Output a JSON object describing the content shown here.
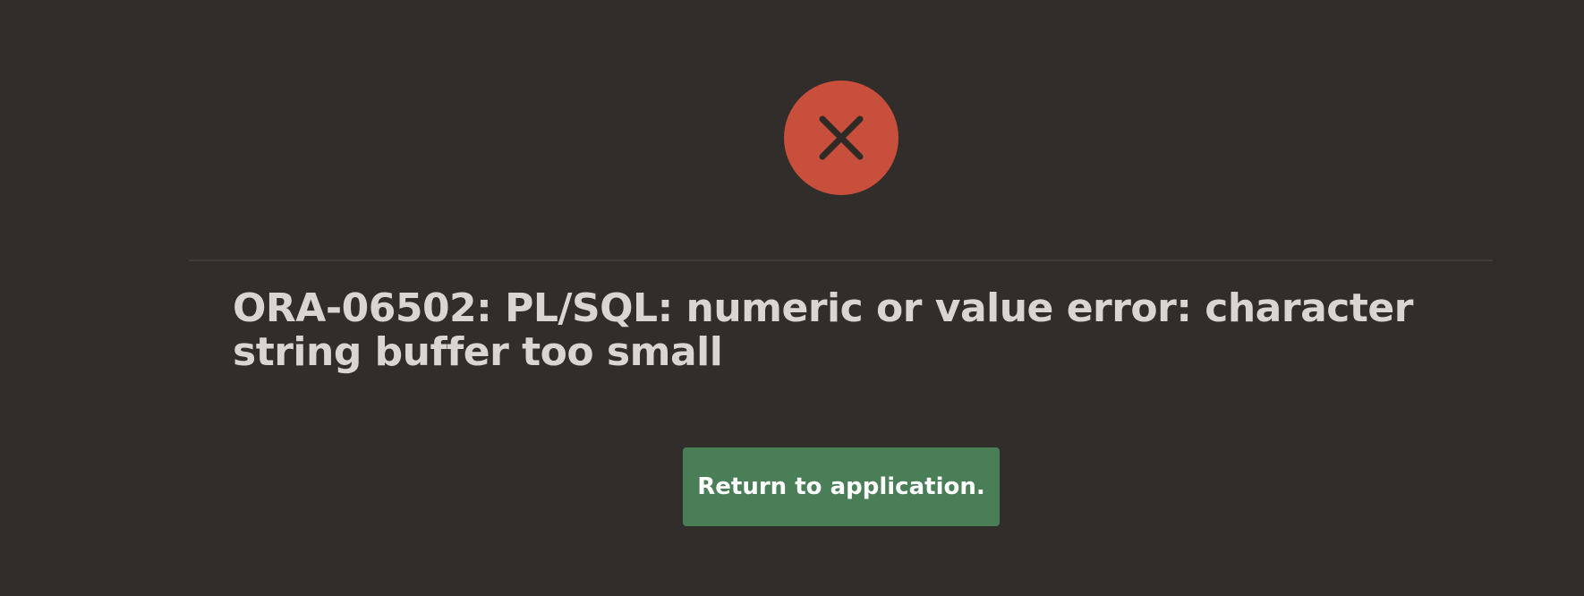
{
  "error": {
    "icon": "close-icon",
    "icon_color": "#c74f3b",
    "message": "ORA-06502: PL/SQL: numeric or value error: character string buffer too small"
  },
  "actions": {
    "return_label": "Return to application.",
    "return_color": "#4a7e57"
  },
  "theme": {
    "background": "#312d2a",
    "text_color": "#d9d6d2"
  }
}
